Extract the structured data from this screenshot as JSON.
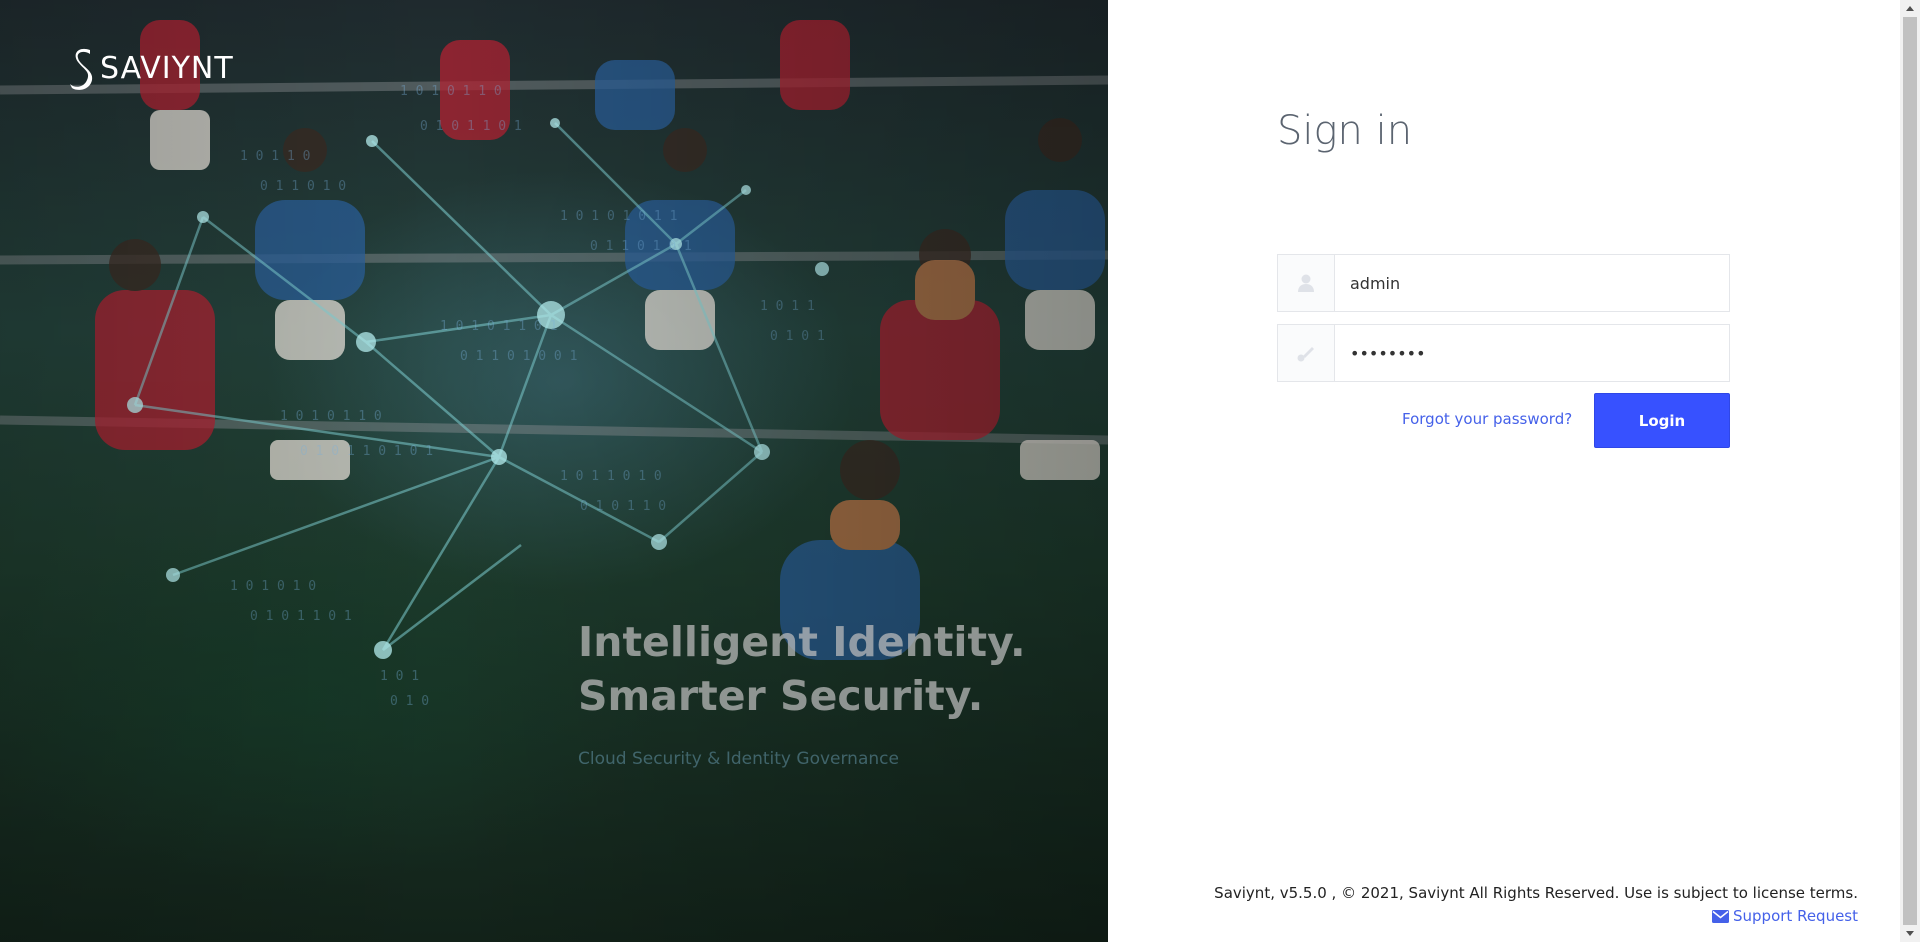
{
  "brand": {
    "name": "SAVIYNT"
  },
  "hero": {
    "headline_line1": "Intelligent Identity.",
    "headline_line2": "Smarter Security.",
    "subline": "Cloud Security & Identity Governance"
  },
  "form": {
    "title": "Sign in",
    "username_value": "admin",
    "password_value": "password",
    "forgot_label": "Forgot your password?",
    "login_label": "Login"
  },
  "footer": {
    "copyright": "Saviynt, v5.5.0 , © 2021, Saviynt All Rights Reserved. Use is subject to license terms.",
    "support_label": "Support Request"
  },
  "icons": {
    "user": "user-icon",
    "key": "key-icon",
    "mail": "envelope-icon"
  },
  "colors": {
    "accent": "#3751ff",
    "link": "#4561e9",
    "title": "#5b6470"
  }
}
